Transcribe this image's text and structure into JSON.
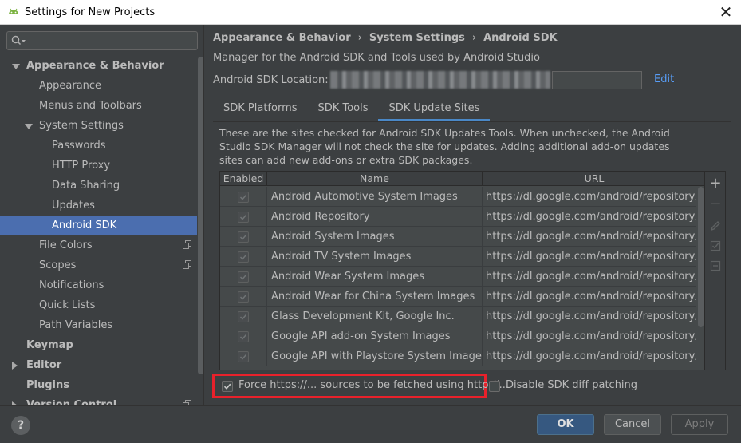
{
  "window": {
    "title": "Settings for New Projects",
    "close_glyph": "✕"
  },
  "sidebar": {
    "search": {
      "value": "",
      "placeholder": ""
    },
    "items": [
      {
        "label": "Appearance & Behavior",
        "level": 0,
        "bold": true,
        "arrow": "down",
        "copy": false,
        "selected": false
      },
      {
        "label": "Appearance",
        "level": 1,
        "bold": false,
        "arrow": "",
        "copy": false,
        "selected": false
      },
      {
        "label": "Menus and Toolbars",
        "level": 1,
        "bold": false,
        "arrow": "",
        "copy": false,
        "selected": false
      },
      {
        "label": "System Settings",
        "level": 1,
        "bold": false,
        "arrow": "down",
        "copy": false,
        "selected": false
      },
      {
        "label": "Passwords",
        "level": 2,
        "bold": false,
        "arrow": "",
        "copy": false,
        "selected": false
      },
      {
        "label": "HTTP Proxy",
        "level": 2,
        "bold": false,
        "arrow": "",
        "copy": false,
        "selected": false
      },
      {
        "label": "Data Sharing",
        "level": 2,
        "bold": false,
        "arrow": "",
        "copy": false,
        "selected": false
      },
      {
        "label": "Updates",
        "level": 2,
        "bold": false,
        "arrow": "",
        "copy": false,
        "selected": false
      },
      {
        "label": "Android SDK",
        "level": 2,
        "bold": false,
        "arrow": "",
        "copy": false,
        "selected": true
      },
      {
        "label": "File Colors",
        "level": 1,
        "bold": false,
        "arrow": "",
        "copy": true,
        "selected": false
      },
      {
        "label": "Scopes",
        "level": 1,
        "bold": false,
        "arrow": "",
        "copy": true,
        "selected": false
      },
      {
        "label": "Notifications",
        "level": 1,
        "bold": false,
        "arrow": "",
        "copy": false,
        "selected": false
      },
      {
        "label": "Quick Lists",
        "level": 1,
        "bold": false,
        "arrow": "",
        "copy": false,
        "selected": false
      },
      {
        "label": "Path Variables",
        "level": 1,
        "bold": false,
        "arrow": "",
        "copy": false,
        "selected": false
      },
      {
        "label": "Keymap",
        "level": 0,
        "bold": true,
        "arrow": "",
        "copy": false,
        "selected": false
      },
      {
        "label": "Editor",
        "level": 0,
        "bold": true,
        "arrow": "right",
        "copy": false,
        "selected": false
      },
      {
        "label": "Plugins",
        "level": 0,
        "bold": true,
        "arrow": "",
        "copy": false,
        "selected": false
      },
      {
        "label": "Version Control",
        "level": 0,
        "bold": true,
        "arrow": "right",
        "copy": true,
        "selected": false
      }
    ]
  },
  "main": {
    "breadcrumb": [
      "Appearance & Behavior",
      "System Settings",
      "Android SDK"
    ],
    "breadcrumb_sep": "›",
    "description": "Manager for the Android SDK and Tools used by Android Studio",
    "sdk_location_label": "Android SDK Location:",
    "sdk_location_value": "",
    "edit_link": "Edit",
    "tabs": [
      {
        "label": "SDK Platforms",
        "active": false
      },
      {
        "label": "SDK Tools",
        "active": false
      },
      {
        "label": "SDK Update Sites",
        "active": true
      }
    ],
    "sites_description": "These are the sites checked for Android SDK Updates Tools. When unchecked, the Android Studio SDK Manager will not check the site for updates. Adding additional add-on updates sites can add new add-ons or extra SDK packages.",
    "table": {
      "headers": [
        "Enabled",
        "Name",
        "URL"
      ],
      "rows": [
        {
          "enabled": true,
          "name": "Android Automotive System Images",
          "url": "https://dl.google.com/android/repository/..."
        },
        {
          "enabled": true,
          "name": "Android Repository",
          "url": "https://dl.google.com/android/repository/..."
        },
        {
          "enabled": true,
          "name": "Android System Images",
          "url": "https://dl.google.com/android/repository/..."
        },
        {
          "enabled": true,
          "name": "Android TV System Images",
          "url": "https://dl.google.com/android/repository/..."
        },
        {
          "enabled": true,
          "name": "Android Wear System Images",
          "url": "https://dl.google.com/android/repository/..."
        },
        {
          "enabled": true,
          "name": "Android Wear for China System Images",
          "url": "https://dl.google.com/android/repository/..."
        },
        {
          "enabled": true,
          "name": "Glass Development Kit, Google Inc.",
          "url": "https://dl.google.com/android/repository/..."
        },
        {
          "enabled": true,
          "name": "Google API add-on System Images",
          "url": "https://dl.google.com/android/repository/..."
        },
        {
          "enabled": true,
          "name": "Google API with Playstore System Images",
          "url": "https://dl.google.com/android/repository/..."
        }
      ]
    },
    "toolbar": {
      "add": "+",
      "remove": "−"
    },
    "options": {
      "force_https": {
        "label": "Force https://... sources to be fetched using http://...",
        "checked": true
      },
      "disable_diff": {
        "label": "Disable SDK diff patching",
        "checked": false
      }
    }
  },
  "footer": {
    "help": "?",
    "ok": "OK",
    "cancel": "Cancel",
    "apply": "Apply"
  },
  "colors": {
    "selection": "#4b6eaf",
    "link": "#589df6",
    "highlight_border": "#e8212b",
    "ok_button": "#365880"
  }
}
